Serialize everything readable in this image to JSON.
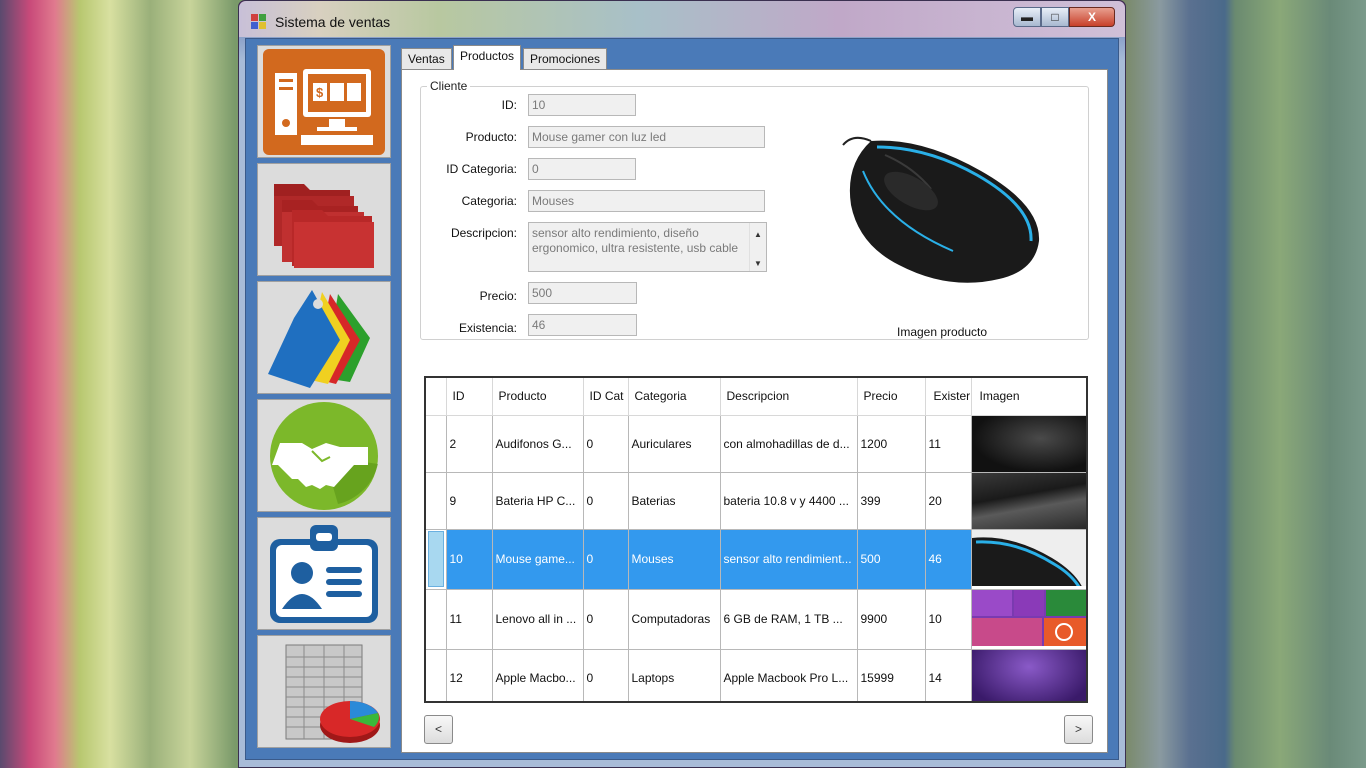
{
  "window": {
    "title": "Sistema de ventas",
    "minimize": "▬",
    "maximize": "□",
    "close": "X"
  },
  "sidebar": {
    "items": [
      {
        "name": "ventas",
        "icon": "point-of-sale-computer-icon"
      },
      {
        "name": "carpetas",
        "icon": "folders-icon"
      },
      {
        "name": "etiquetas",
        "icon": "price-tags-icon"
      },
      {
        "name": "clientes",
        "icon": "handshake-icon"
      },
      {
        "name": "empleados",
        "icon": "id-badge-icon"
      },
      {
        "name": "reportes",
        "icon": "spreadsheet-chart-icon"
      }
    ]
  },
  "tabs": [
    {
      "label": "Ventas",
      "active": false
    },
    {
      "label": "Productos",
      "active": true
    },
    {
      "label": "Promociones",
      "active": false
    }
  ],
  "form": {
    "group_title": "Cliente",
    "id_label": "ID:",
    "id_value": "10",
    "producto_label": "Producto:",
    "producto_value": "Mouse gamer con luz led",
    "idcat_label": "ID Categoria:",
    "idcat_value": "0",
    "categoria_label": "Categoria:",
    "categoria_value": "Mouses",
    "descripcion_label": "Descripcion:",
    "descripcion_value": "sensor alto rendimiento, diseño ergonomico, ultra resistente, usb cable",
    "precio_label": "Precio:",
    "precio_value": "500",
    "existencia_label": "Existencia:",
    "existencia_value": "46",
    "image_caption": "Imagen producto"
  },
  "grid": {
    "columns": [
      "ID",
      "Producto",
      "ID Cat",
      "Categoria",
      "Descripcion",
      "Precio",
      "Exister",
      "Imagen"
    ],
    "rows": [
      {
        "id": "2",
        "producto": "Audifonos G...",
        "idcat": "0",
        "categoria": "Auriculares",
        "descripcion": "con almohadillas de d...",
        "precio": "1200",
        "existencia": "11",
        "thumb": "dark-headphones"
      },
      {
        "id": "9",
        "producto": "Bateria HP C...",
        "idcat": "0",
        "categoria": "Baterias",
        "descripcion": "bateria 10.8 v y 4400 ...",
        "precio": "399",
        "existencia": "20",
        "thumb": "hp-battery"
      },
      {
        "id": "10",
        "producto": "Mouse game...",
        "idcat": "0",
        "categoria": "Mouses",
        "descripcion": "sensor alto rendimient...",
        "precio": "500",
        "existencia": "46",
        "thumb": "mouse",
        "selected": true
      },
      {
        "id": "11",
        "producto": "Lenovo all in ...",
        "idcat": "0",
        "categoria": "Computadoras",
        "descripcion": "6 GB de RAM, 1 TB ...",
        "precio": "9900",
        "existencia": "10",
        "thumb": "windows-tiles"
      },
      {
        "id": "12",
        "producto": "Apple Macbo...",
        "idcat": "0",
        "categoria": "Laptops",
        "descripcion": "Apple Macbook Pro L...",
        "precio": "15999",
        "existencia": "14",
        "thumb": "purple-wallpaper"
      }
    ]
  },
  "nav": {
    "prev": "<",
    "next": ">"
  }
}
